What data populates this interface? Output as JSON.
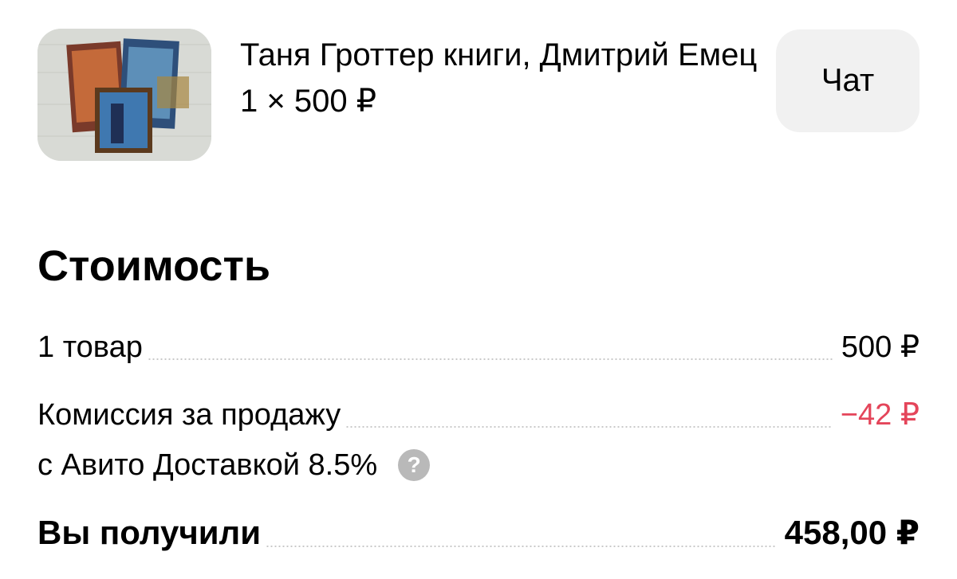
{
  "product": {
    "title": "Таня Гроттер книги, Дмитрий Емец",
    "price_line": "1 × 500 ₽"
  },
  "chat_button": {
    "label": "Чат"
  },
  "cost": {
    "title": "Стоимость",
    "items_label": "1 товар",
    "items_value": "500 ₽",
    "commission_label_line1": "Комиссия за продажу",
    "commission_label_line2": "с Авито Доставкой 8.5%",
    "commission_value": "−42 ₽",
    "help_icon_glyph": "?",
    "total_label": "Вы получили",
    "total_value": "458,00 ₽"
  },
  "colors": {
    "negative": "#e4455a",
    "button_bg": "#f1f1f1",
    "help_icon_bg": "#b9b9b9"
  },
  "icons": {
    "help": "question-circle-icon"
  }
}
